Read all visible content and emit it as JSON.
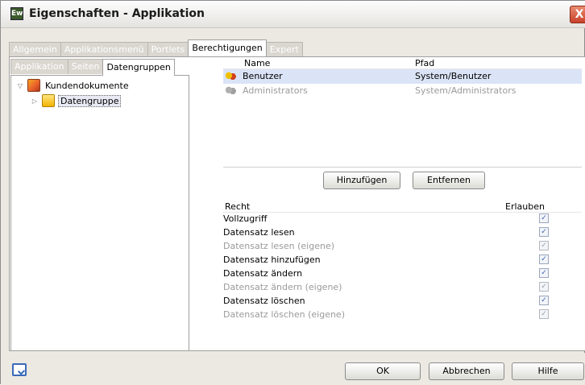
{
  "window": {
    "title": "Eigenschaften - Applikation",
    "app_icon": "Ew",
    "close_label": "X"
  },
  "tabs": [
    "Allgemein",
    "Applikationsmenü",
    "Portlets",
    "Berechtigungen",
    "Expert"
  ],
  "active_tab": 3,
  "subtabs": [
    "Applikation",
    "Seiten",
    "Datengruppen"
  ],
  "active_subtab": 2,
  "tree": {
    "root": "Kundendokumente",
    "child": "Datengruppe"
  },
  "users": {
    "headers": {
      "name": "Name",
      "path": "Pfad"
    },
    "rows": [
      {
        "name": "Benutzer",
        "path": "System/Benutzer",
        "icon": "group-icon"
      },
      {
        "name": "Administrators",
        "path": "System/Administrators",
        "icon": "group-icon-disabled"
      }
    ]
  },
  "buttons": {
    "add": "Hinzufügen",
    "remove": "Entfernen",
    "ok": "OK",
    "cancel": "Abbrechen",
    "help": "Hilfe"
  },
  "rights": {
    "headers": {
      "right": "Recht",
      "allow": "Erlauben"
    },
    "rows": [
      {
        "label": "Vollzugriff",
        "enabled": true,
        "checked": true
      },
      {
        "label": "Datensatz lesen",
        "enabled": true,
        "checked": true
      },
      {
        "label": "Datensatz lesen (eigene)",
        "enabled": false,
        "checked": true
      },
      {
        "label": "Datensatz hinzufügen",
        "enabled": true,
        "checked": true
      },
      {
        "label": "Datensatz ändern",
        "enabled": true,
        "checked": true
      },
      {
        "label": "Datensatz ändern (eigene)",
        "enabled": false,
        "checked": true
      },
      {
        "label": "Datensatz löschen",
        "enabled": true,
        "checked": true
      },
      {
        "label": "Datensatz löschen (eigene)",
        "enabled": false,
        "checked": true
      }
    ]
  },
  "colors": {
    "selection": "#dbe4f6",
    "close": "#c8422a",
    "check": "#3a63b0"
  }
}
